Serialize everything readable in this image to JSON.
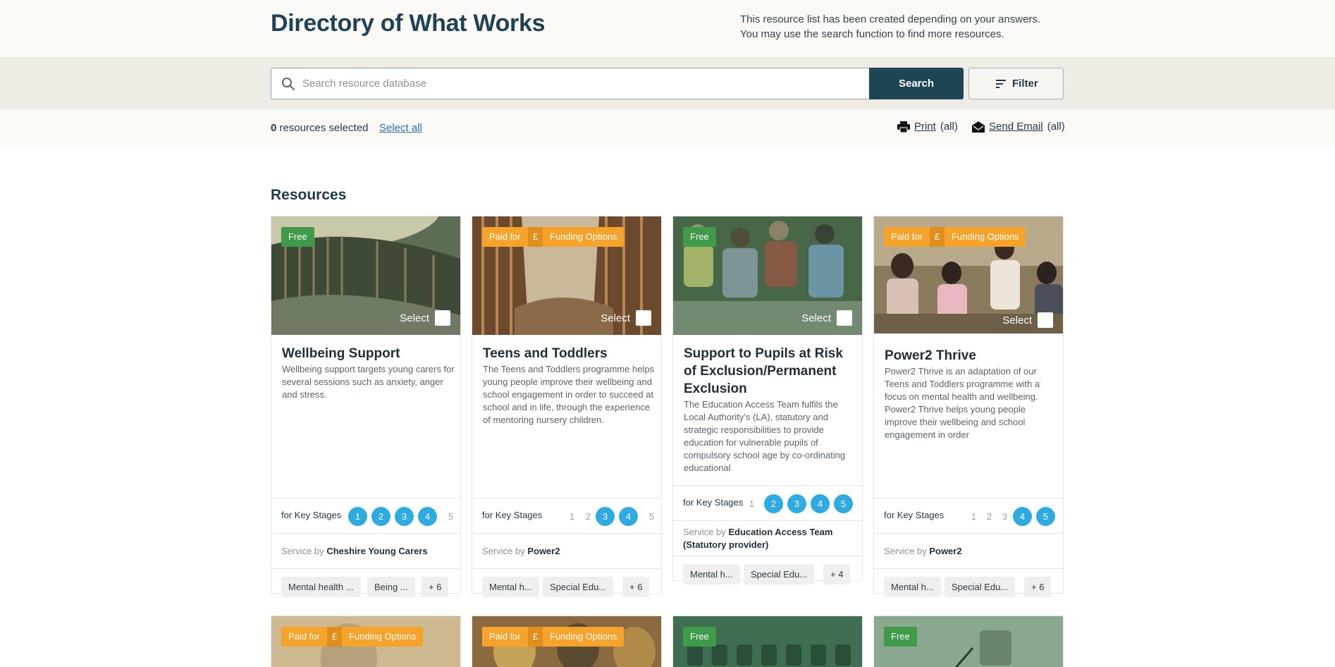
{
  "header": {
    "title": "Directory of What Works",
    "intro_line1": "This resource list has been created depending on your answers.",
    "intro_line2": "You may use the search function to find more resources."
  },
  "search": {
    "placeholder": "Search resource database",
    "button_label": "Search",
    "filter_label": "Filter"
  },
  "selection": {
    "count": "0",
    "count_suffix": "resources selected",
    "select_all": "Select all",
    "print_label": "Print",
    "print_scope": "(all)",
    "email_label": "Send Email",
    "email_scope": "(all)"
  },
  "resources_title": "Resources",
  "common": {
    "key_stages_label": "for Key Stages",
    "select_label": "Select",
    "service_prefix": "Service by",
    "paid": "Paid for",
    "pound": "£",
    "funding": "Funding Options",
    "free": "Free"
  },
  "cards": [
    {
      "title": "Wellbeing Support",
      "description": "Wellbeing support targets young carers for several sessions such as anxiety, anger and stress.",
      "pricing": "free",
      "key_stages": [
        1,
        2,
        3,
        4
      ],
      "service_by": "Cheshire Young Carers",
      "tags": [
        "Mental health ...",
        "Being ...",
        "+ 6"
      ]
    },
    {
      "title": "Teens and Toddlers",
      "description": "The Teens and Toddlers programme helps young people improve their wellbeing and school engagement in order to succeed at school and in life, through the experience of mentoring nursery children.",
      "pricing": "paid",
      "key_stages": [
        3,
        4
      ],
      "service_by": "Power2",
      "tags": [
        "Mental h...",
        "Special Edu...",
        "+ 6"
      ]
    },
    {
      "title": "Support to Pupils at Risk of Exclusion/Permanent Exclusion",
      "description": "The Education Access Team fulfils the Local Authority’s (LA), statutory and strategic responsibilities to provide education for vulnerable pupils of compulsory school age by co-ordinating educational",
      "pricing": "free",
      "key_stages": [
        2,
        3,
        4,
        5
      ],
      "service_by": "Education Access Team (Statutory provider)",
      "tags": [
        "Mental h...",
        "Special Edu...",
        "+ 4"
      ]
    },
    {
      "title": "Power2 Thrive",
      "description": "Power2 Thrive is an adaptation of our Teens and Toddlers programme with a focus on mental health and wellbeing. Power2 Thrive helps young people improve their wellbeing and school engagement in order",
      "pricing": "paid",
      "key_stages": [
        4,
        5
      ],
      "service_by": "Power2",
      "tags": [
        "Mental h...",
        "Special Edu...",
        "+ 6"
      ]
    }
  ],
  "row2": [
    {
      "pricing": "paid"
    },
    {
      "pricing": "paid"
    },
    {
      "pricing": "free"
    },
    {
      "pricing": "free"
    }
  ],
  "colors": {
    "primary": "#1e4553",
    "free": "#3f9b49",
    "paid": "#f5a32a",
    "key_stage": "#2eace2",
    "link": "#2a6fb0"
  }
}
